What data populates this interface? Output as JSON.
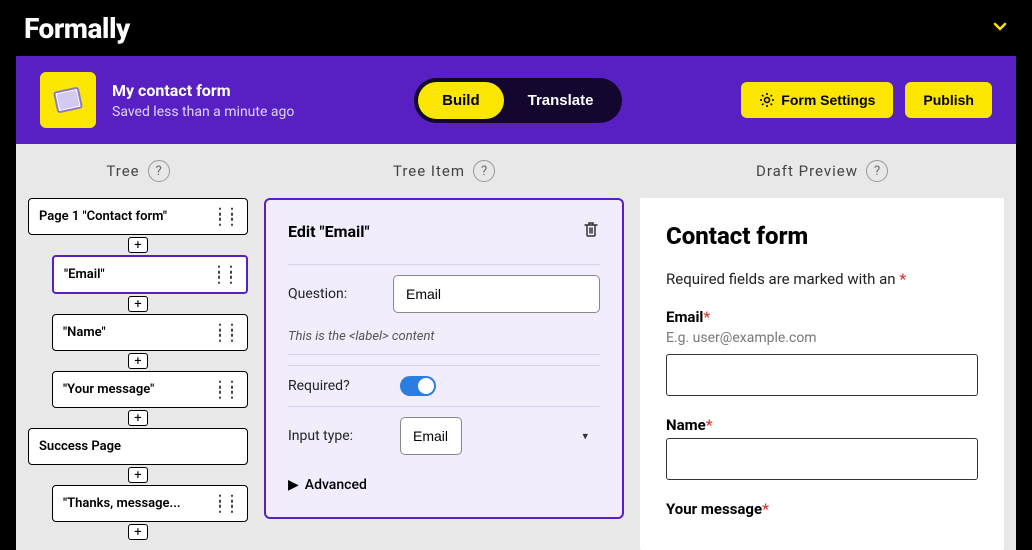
{
  "app": {
    "name": "Formally"
  },
  "form": {
    "title": "My contact form",
    "saved": "Saved less than a minute ago"
  },
  "modes": {
    "build": "Build",
    "translate": "Translate"
  },
  "actions": {
    "settings": "Form Settings",
    "publish": "Publish"
  },
  "columns": {
    "tree": "Tree",
    "treeItem": "Tree Item",
    "preview": "Draft Preview"
  },
  "tree": {
    "page1": "Page 1 \"Contact form\"",
    "email": "\"Email\"",
    "name": "\"Name\"",
    "message": "\"Your message\"",
    "success": "Success Page",
    "thanks": "\"Thanks, message..."
  },
  "edit": {
    "title": "Edit \"Email\"",
    "questionLabel": "Question:",
    "questionValue": "Email",
    "hint": "This is the <label> content",
    "requiredLabel": "Required?",
    "inputTypeLabel": "Input type:",
    "inputTypeValue": "Email",
    "advanced": "Advanced"
  },
  "preview": {
    "heading": "Contact form",
    "reqNote": "Required fields are marked with an",
    "emailLabel": "Email",
    "emailHint": "E.g. user@example.com",
    "nameLabel": "Name",
    "messageLabel": "Your message"
  }
}
